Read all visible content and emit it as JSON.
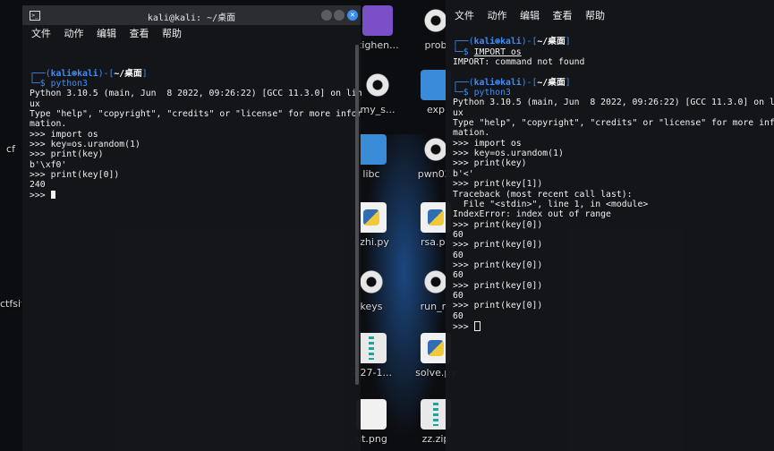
{
  "desktop": {
    "icons_left": [
      {
        "label": "cf",
        "type": "folder"
      },
      {
        "label": "ctfsitepy",
        "type": "folder"
      }
    ],
    "icons": [
      {
        "label": "cighen...",
        "type": "php"
      },
      {
        "label": "prob",
        "type": "gear"
      },
      {
        "label": "my_s...",
        "type": "gear"
      },
      {
        "label": "exp",
        "type": "folder"
      },
      {
        "label": "libc",
        "type": "folder"
      },
      {
        "label": "pwn02.",
        "type": "gear"
      },
      {
        "label": "nzhi.py",
        "type": "pyfile"
      },
      {
        "label": "rsa.py",
        "type": "pyfile"
      },
      {
        "label": "keys",
        "type": "gear"
      },
      {
        "label": "run_m",
        "type": "gear"
      },
      {
        "label": "2.27-1...",
        "type": "zip"
      },
      {
        "label": "solve.py",
        "type": "pyfile"
      },
      {
        "label": "ut.png",
        "type": "imgfile"
      },
      {
        "label": "zz.zip",
        "type": "zip"
      }
    ]
  },
  "term_left": {
    "title": "kali@kali: ~/桌面",
    "menu": [
      "文件",
      "动作",
      "编辑",
      "查看",
      "帮助"
    ],
    "lines": [
      "",
      "Python 3.10.5 (main, Jun  8 2022, 09:26:22) [GCC 11.3.0] on lin",
      "ux",
      "Type \"help\", \"copyright\", \"credits\" or \"license\" for more infor",
      "mation.",
      ">>> import os",
      ">>> key=os.urandom(1)",
      ">>> print(key)",
      "b'\\xf0'",
      ">>> print(key[0])",
      "240",
      ">>> "
    ],
    "prompt_user": "kali⊛kali",
    "prompt_path": "~/桌面",
    "command": "python3"
  },
  "term_right": {
    "title": "kali@kali: ~/桌面",
    "menu": [
      "文件",
      "动作",
      "编辑",
      "查看",
      "帮助"
    ],
    "prompt_user": "kali⊛kali",
    "prompt_path": "~/桌面",
    "command1": "IMPORT os",
    "error1": "IMPORT: command not found",
    "command2": "python3",
    "lines": [
      "Python 3.10.5 (main, Jun  8 2022, 09:26:22) [GCC 11.3.0] on lin",
      "ux",
      "Type \"help\", \"copyright\", \"credits\" or \"license\" for more infor",
      "mation.",
      ">>> import os",
      ">>> key=os.urandom(1)",
      ">>> print(key)",
      "b'<'",
      ">>> print(key[1])",
      "Traceback (most recent call last):",
      "  File \"<stdin>\", line 1, in <module>",
      "IndexError: index out of range",
      ">>> print(key[0])",
      "60",
      ">>> print(key[0])",
      "60",
      ">>> print(key[0])",
      "60",
      ">>> print(key[0])",
      "60",
      ">>> print(key[0])",
      "60",
      ">>> "
    ]
  }
}
